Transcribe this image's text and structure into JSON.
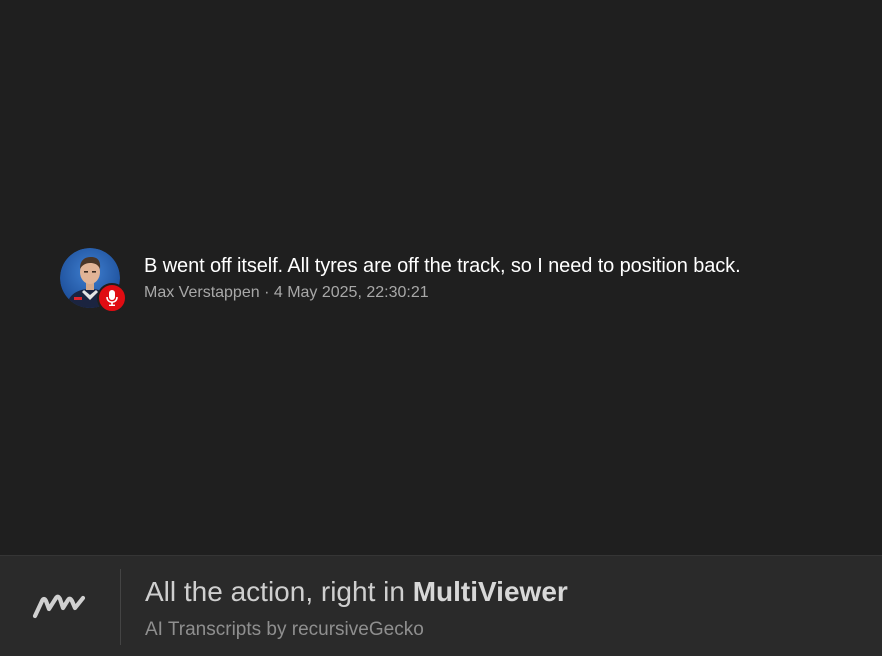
{
  "transcript": {
    "text": "B went off itself. All tyres are off the track, so I need to position back.",
    "speaker": "Max Verstappen",
    "separator": " · ",
    "timestamp": "4 May 2025, 22:30:21",
    "badge_color": "#e00c12"
  },
  "footer": {
    "headline_prefix": "All the action, right in ",
    "headline_brand": "MultiViewer",
    "subtitle": "AI Transcripts by recursiveGecko",
    "logo_icon": "multiviewer-logo-icon"
  },
  "colors": {
    "background": "#1f1f1f",
    "footer_background": "#2a2a2a"
  }
}
